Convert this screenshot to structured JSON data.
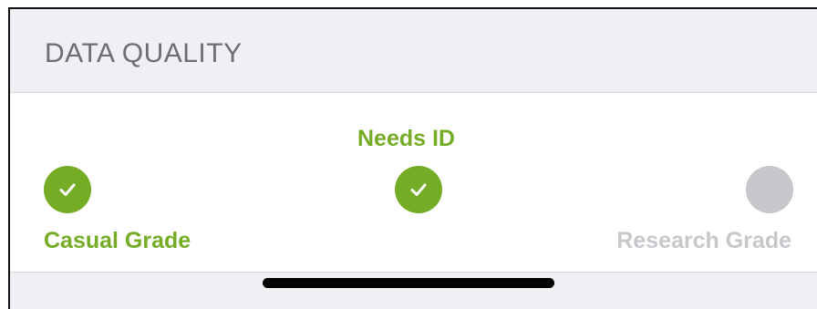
{
  "section": {
    "title": "DATA QUALITY"
  },
  "quality": {
    "steps": [
      {
        "label": "Casual Grade",
        "state": "complete",
        "icon": "checkmark-icon"
      },
      {
        "label": "Needs ID",
        "state": "complete",
        "icon": "checkmark-icon"
      },
      {
        "label": "Research Grade",
        "state": "pending",
        "icon": "empty-circle-icon"
      }
    ],
    "colors": {
      "active": "#74ac26",
      "inactive": "#c7c7cc"
    }
  }
}
